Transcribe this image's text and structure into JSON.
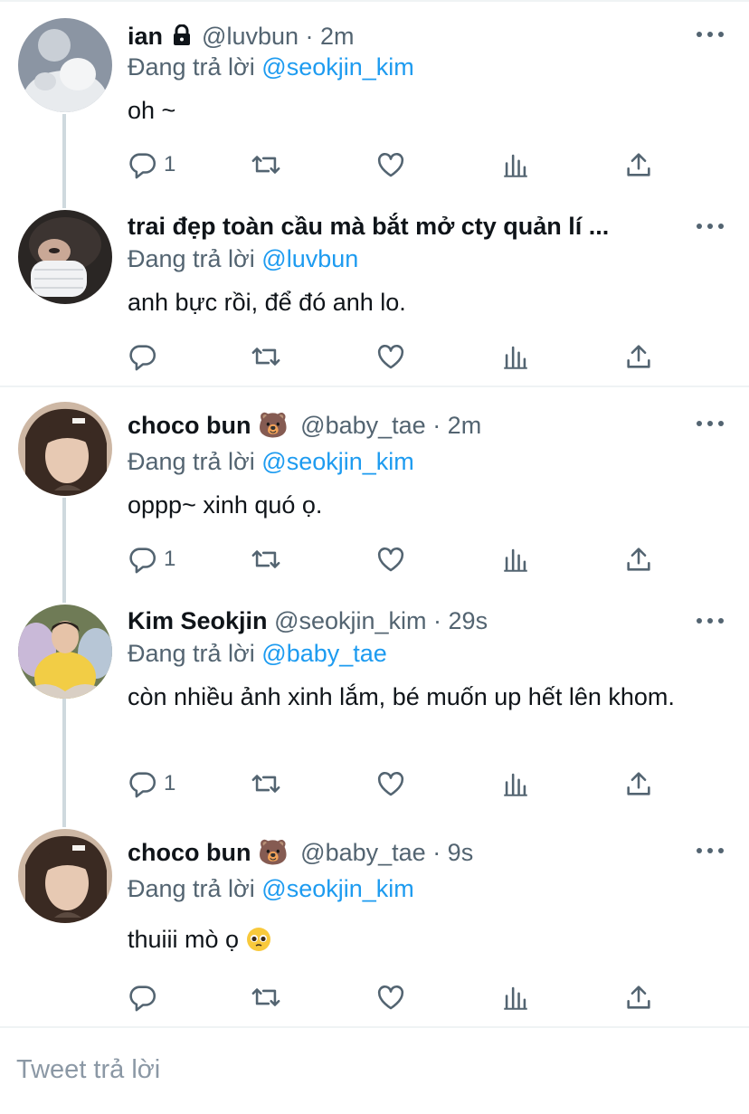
{
  "tweets": [
    {
      "name": "ian",
      "badge": "lock",
      "handle": "@luvbun",
      "time": "· 2m",
      "reply_prefix": "Đang trả lời",
      "reply_to": "@seokjin_kim",
      "text": "oh ~",
      "reply_count": "1"
    },
    {
      "name": "trai đẹp toàn cầu mà bắt mở cty quản lí ...",
      "handle": "",
      "time": "",
      "reply_prefix": "Đang trả lời",
      "reply_to": "@luvbun",
      "text": "anh bực rồi, để đó anh lo.",
      "reply_count": ""
    },
    {
      "name": "choco bun",
      "badge": "🐻",
      "handle": "@baby_tae",
      "time": "· 2m",
      "reply_prefix": "Đang trả lời",
      "reply_to": "@seokjin_kim",
      "text": "oppp~ xinh quó ọ.",
      "reply_count": "1"
    },
    {
      "name": "Kim Seokjin",
      "handle": "@seokjin_kim",
      "time": "· 29s",
      "reply_prefix": "Đang trả lời",
      "reply_to": "@baby_tae",
      "text": "còn nhiều ảnh xinh lắm, bé muốn up hết lên khom.",
      "reply_count": "1"
    },
    {
      "name": "choco bun",
      "badge": "🐻",
      "handle": "@baby_tae",
      "time": "· 9s",
      "reply_prefix": "Đang trả lời",
      "reply_to": "@seokjin_kim",
      "text": "thuiii mò ọ",
      "text_emoji": "pleading-face",
      "reply_count": ""
    }
  ],
  "icons": {
    "reply": "reply-icon",
    "retweet": "retweet-icon",
    "like": "like-icon",
    "analytics": "analytics-icon",
    "share": "share-icon",
    "more": "more-icon"
  },
  "colors": {
    "accent": "#1d9bf0",
    "secondary_text": "#536471",
    "thread_line": "#cfd9de"
  },
  "compose": {
    "placeholder": "Tweet trả lời"
  }
}
